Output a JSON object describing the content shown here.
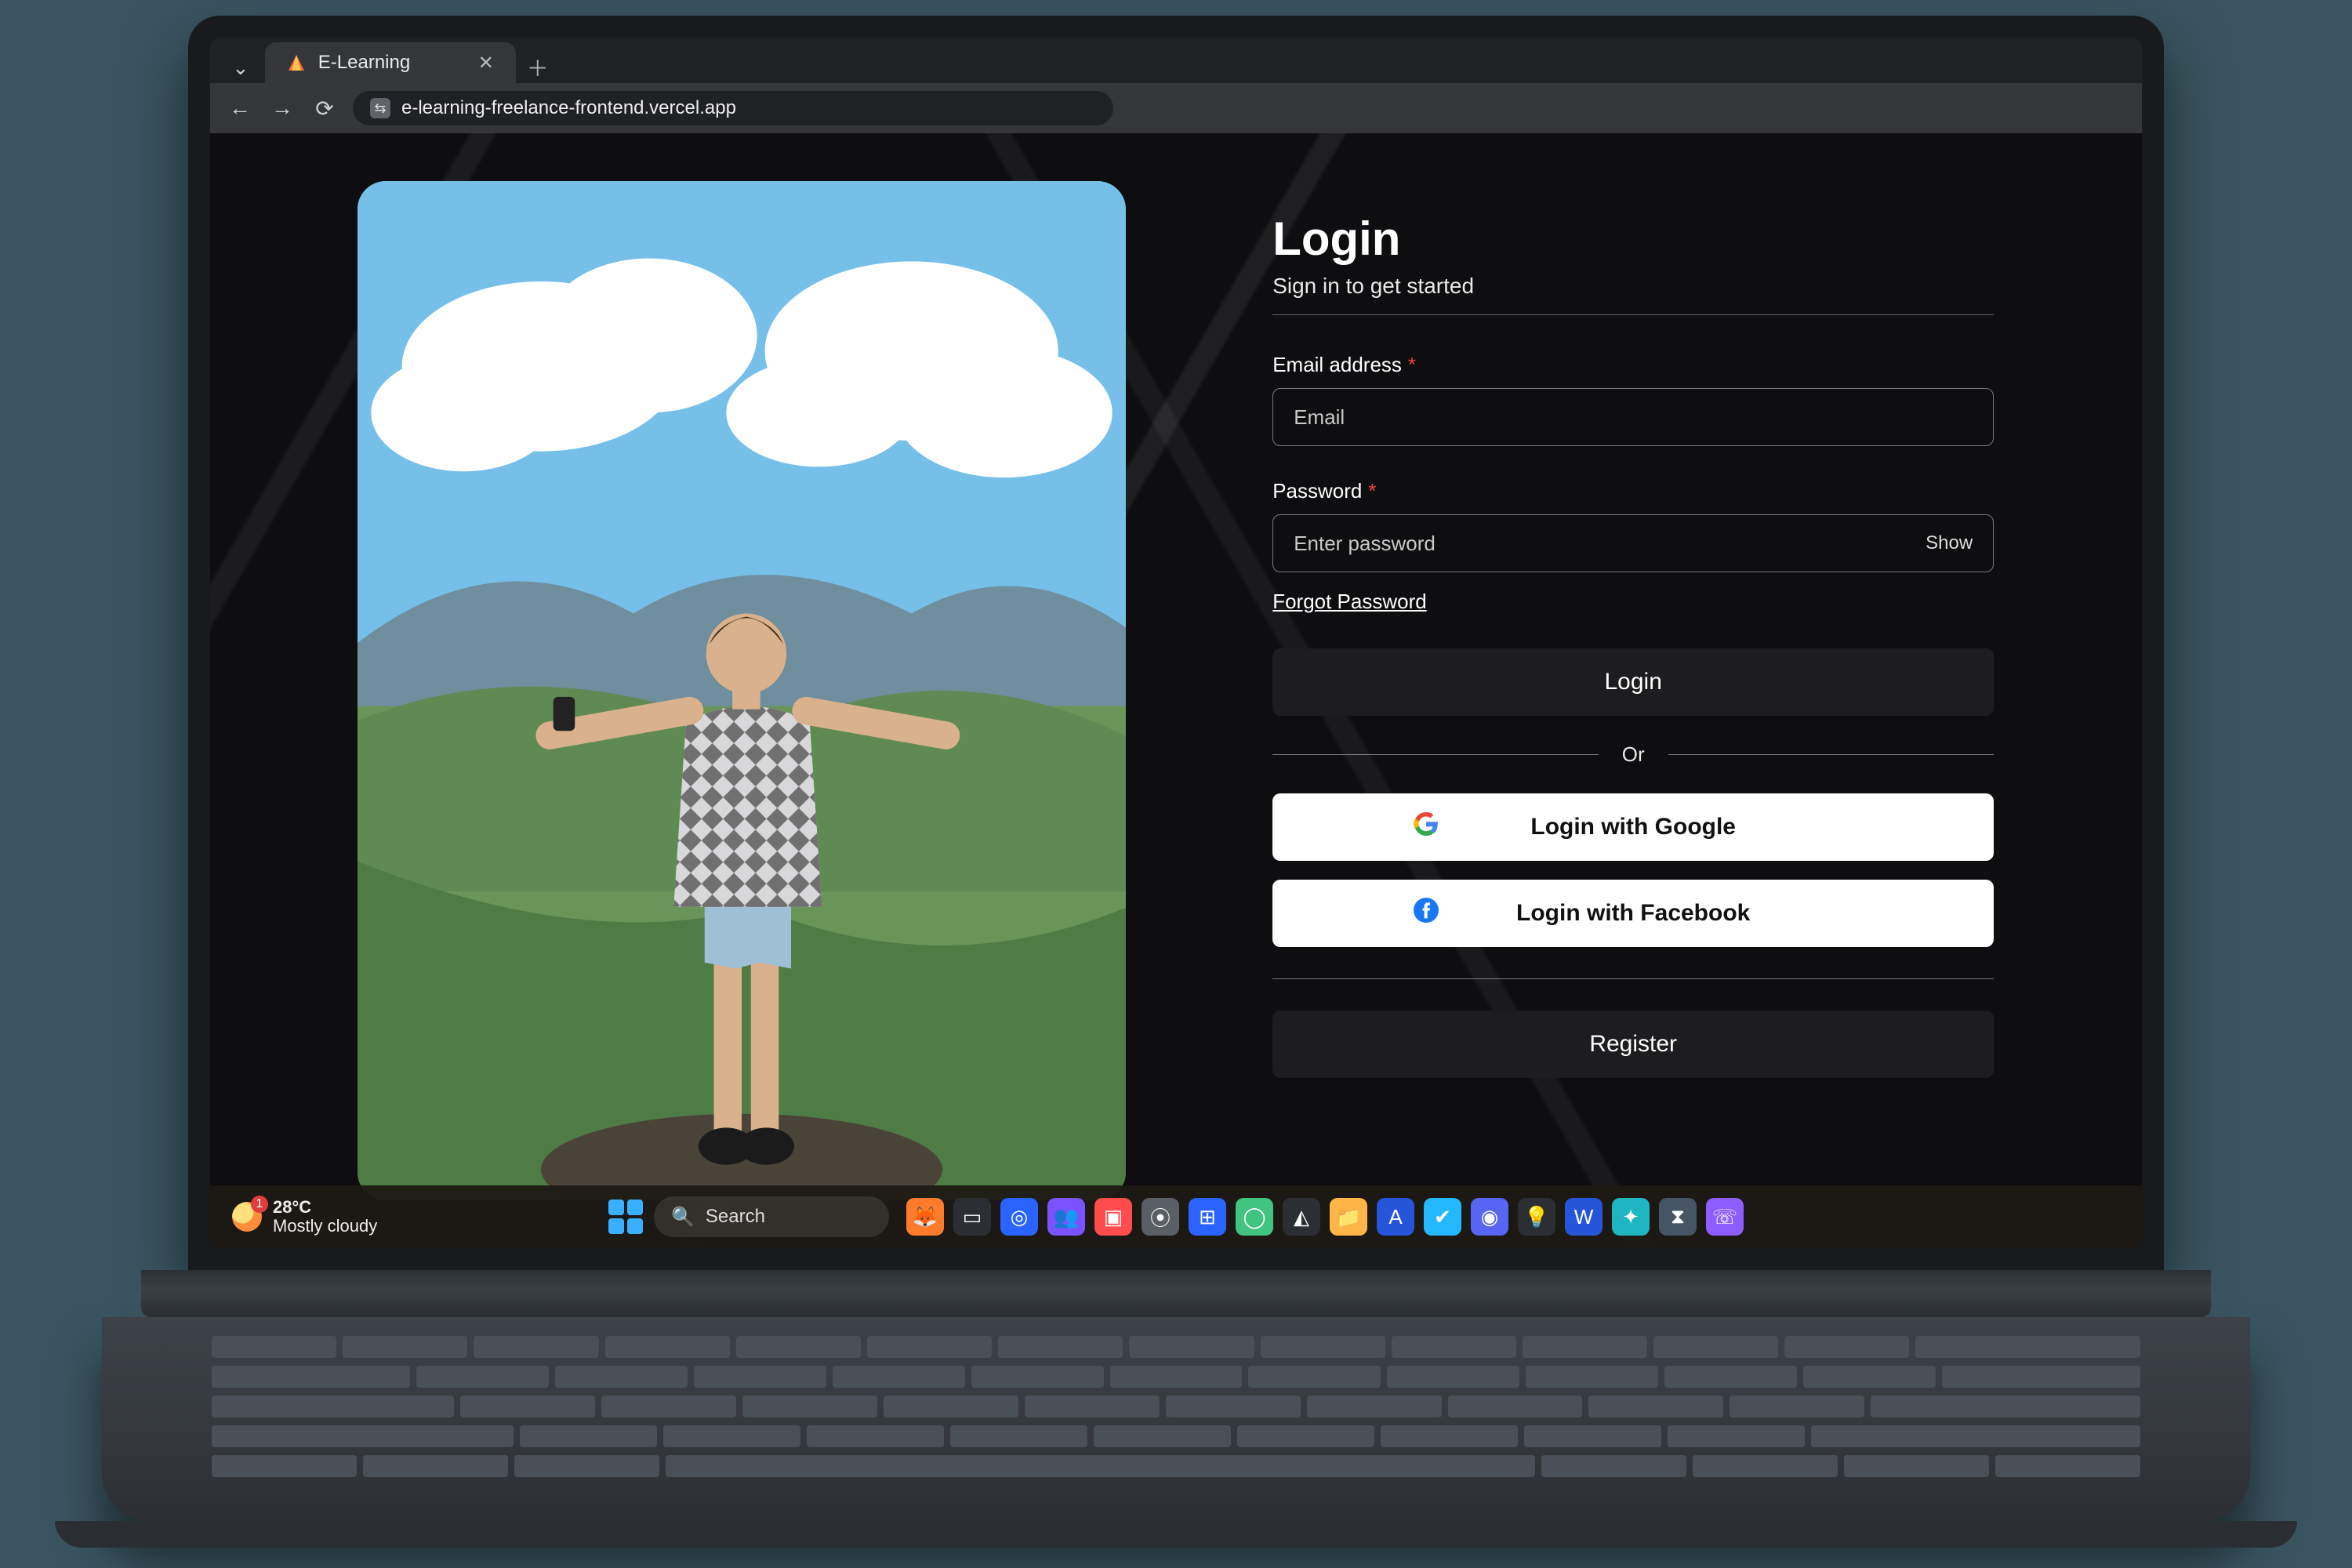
{
  "browser": {
    "tab_title": "E-Learning",
    "url": "e-learning-freelance-frontend.vercel.app"
  },
  "taskbar": {
    "search_placeholder": "Search",
    "weather": {
      "temp": "28°C",
      "desc": "Mostly cloudy"
    }
  },
  "login": {
    "title": "Login",
    "subtitle": "Sign in to get started",
    "email_label": "Email address",
    "email_placeholder": "Email",
    "password_label": "Password",
    "password_placeholder": "Enter password",
    "show_toggle": "Show",
    "forgot": "Forgot Password",
    "login_btn": "Login",
    "or": "Or",
    "google_btn": "Login with Google",
    "facebook_btn": "Login with Facebook",
    "register_btn": "Register",
    "required_mark": "*"
  }
}
